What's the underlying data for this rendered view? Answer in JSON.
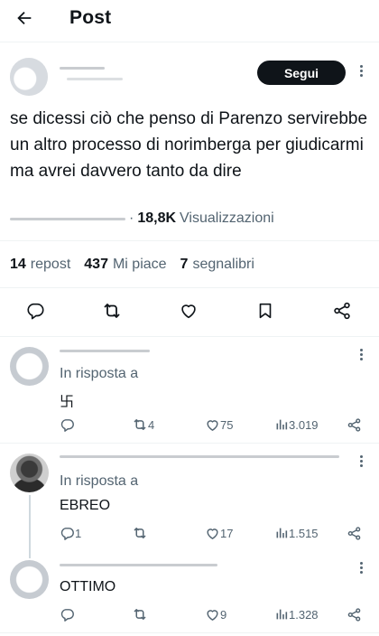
{
  "header": {
    "title": "Post"
  },
  "post": {
    "follow_label": "Segui",
    "text": "se dicessi ciò che penso di Parenzo servirebbe un altro processo di norimberga per giudicarmi ma avrei davvero tanto da dire",
    "views_count": "18,8K",
    "views_label": "Visualizzazioni",
    "separator": "·",
    "reposts_count": "14",
    "reposts_label": "repost",
    "likes_count": "437",
    "likes_label": "Mi piace",
    "bookmarks_count": "7",
    "bookmarks_label": "segnalibri"
  },
  "replies": [
    {
      "in_reply_prefix": "In risposta a",
      "text": "卐",
      "reply_count": "",
      "repost_count": "4",
      "like_count": "75",
      "view_count": "3.019"
    },
    {
      "in_reply_prefix": "In risposta a",
      "text": "EBREO",
      "reply_count": "1",
      "repost_count": "",
      "like_count": "17",
      "view_count": "1.515"
    },
    {
      "text": "OTTIMO",
      "reply_count": "",
      "repost_count": "",
      "like_count": "9",
      "view_count": "1.328"
    }
  ],
  "icons": {
    "back": "arrow-left-icon",
    "more": "more-vertical-icon",
    "reply": "speech-bubble-icon",
    "repost": "repost-arrows-icon",
    "like": "heart-icon",
    "bookmark": "bookmark-icon",
    "share": "share-icon",
    "views": "bar-chart-icon"
  },
  "colors": {
    "text": "#0f1419",
    "muted": "#536471",
    "divider": "#eff3f4",
    "follow_bg": "#0f1419"
  }
}
